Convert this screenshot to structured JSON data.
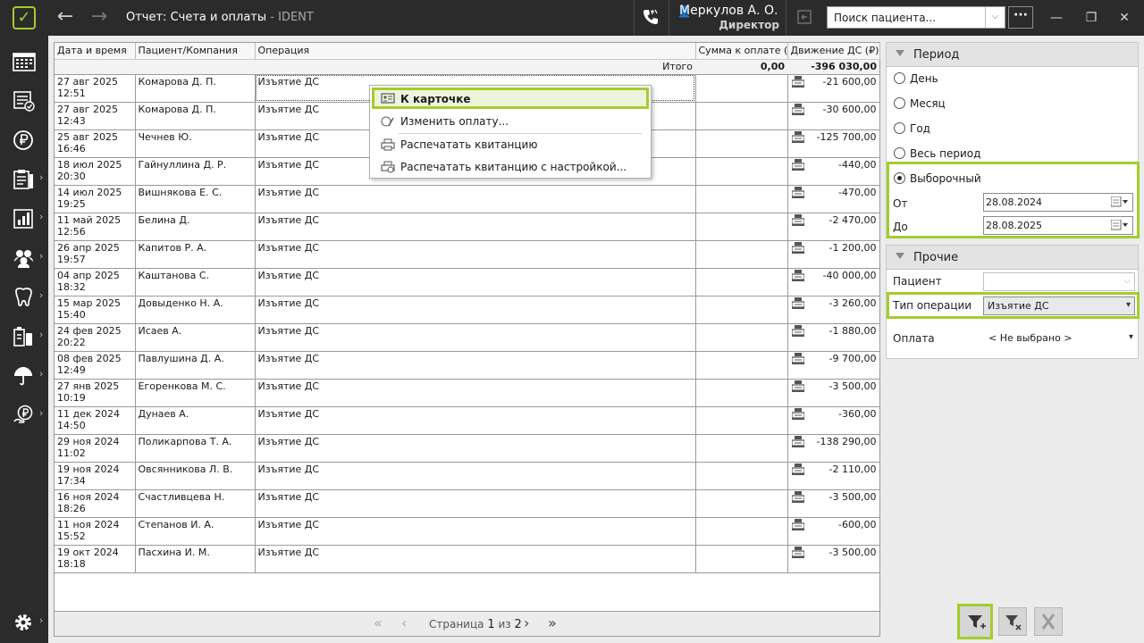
{
  "window": {
    "title": "Отчет: Счета и оплаты",
    "app": "- IDENT"
  },
  "user": {
    "name": "Меркулов А. О.",
    "role": "Директор"
  },
  "search": {
    "placeholder": "Поиск пациента..."
  },
  "table": {
    "columns": [
      "Дата и время",
      "Пациент/Компания",
      "Операция",
      "Сумма к оплате (₽)",
      "Движение ДС (₽)"
    ],
    "total_label": "Итого",
    "total_sum": "0,00",
    "total_move": "-396 030,00",
    "rows": [
      {
        "date": "27 авг 2025",
        "time": "12:51",
        "patient": "Комарова Д. П.",
        "op": "Изъятие ДС",
        "move": "-21 600,00"
      },
      {
        "date": "27 авг 2025",
        "time": "12:43",
        "patient": "Комарова Д. П.",
        "op": "Изъятие ДС",
        "move": "-30 600,00"
      },
      {
        "date": "25 авг 2025",
        "time": "16:46",
        "patient": "Чечнев Ю.",
        "op": "Изъятие ДС",
        "move": "-125 700,00"
      },
      {
        "date": "18 июл 2025",
        "time": "20:30",
        "patient": "Гайнуллина Д. Р.",
        "op": "Изъятие ДС",
        "move": "-440,00"
      },
      {
        "date": "14 июл 2025",
        "time": "19:25",
        "patient": "Вишнякова Е. С.",
        "op": "Изъятие ДС",
        "move": "-470,00"
      },
      {
        "date": "11 май 2025",
        "time": "12:56",
        "patient": "Белина Д.",
        "op": "Изъятие ДС",
        "move": "-2 470,00"
      },
      {
        "date": "26 апр 2025",
        "time": "19:57",
        "patient": "Капитов Р. А.",
        "op": "Изъятие ДС",
        "move": "-1 200,00"
      },
      {
        "date": "04 апр 2025",
        "time": "18:32",
        "patient": "Каштанова С.",
        "op": "Изъятие ДС",
        "move": "-40 000,00"
      },
      {
        "date": "15 мар 2025",
        "time": "15:40",
        "patient": "Довыденко Н. А.",
        "op": "Изъятие ДС",
        "move": "-3 260,00"
      },
      {
        "date": "24 фев 2025",
        "time": "20:22",
        "patient": "Исаев А.",
        "op": "Изъятие ДС",
        "move": "-1 880,00"
      },
      {
        "date": "08 фев 2025",
        "time": "12:49",
        "patient": "Павлушина Д. А.",
        "op": "Изъятие ДС",
        "move": "-9 700,00"
      },
      {
        "date": "27 янв 2025",
        "time": "10:19",
        "patient": "Егоренкова М. С.",
        "op": "Изъятие ДС",
        "move": "-3 500,00"
      },
      {
        "date": "11 дек 2024",
        "time": "14:50",
        "patient": "Дунаев А.",
        "op": "Изъятие ДС",
        "move": "-360,00"
      },
      {
        "date": "29 ноя 2024",
        "time": "11:02",
        "patient": "Поликарпова Т. А.",
        "op": "Изъятие ДС",
        "move": "-138 290,00"
      },
      {
        "date": "19 ноя 2024",
        "time": "17:34",
        "patient": "Овсянникова Л. В.",
        "op": "Изъятие ДС",
        "move": "-2 110,00"
      },
      {
        "date": "16 ноя 2024",
        "time": "18:26",
        "patient": "Счастливцева Н.",
        "op": "Изъятие ДС",
        "move": "-3 500,00"
      },
      {
        "date": "11 ноя 2024",
        "time": "15:52",
        "patient": "Степанов И. А.",
        "op": "Изъятие ДС",
        "move": "-600,00"
      },
      {
        "date": "19 окт 2024",
        "time": "18:18",
        "patient": "Пасхина И. М.",
        "op": "Изъятие ДС",
        "move": "-3 500,00"
      }
    ]
  },
  "pager": {
    "label": "Страница",
    "current": "1",
    "of": "из",
    "total": "2"
  },
  "context_menu": {
    "items": [
      "К карточке",
      "Изменить оплату...",
      "Распечатать квитанцию",
      "Распечатать квитанцию с настройкой..."
    ]
  },
  "filters": {
    "period_title": "Период",
    "period_options": [
      "День",
      "Месяц",
      "Год",
      "Весь период",
      "Выборочный"
    ],
    "selected_period": "Выборочный",
    "from_label": "От",
    "from_value": "28.08.2024",
    "to_label": "До",
    "to_value": "28.08.2025",
    "other_title": "Прочие",
    "patient_label": "Пациент",
    "patient_value": "",
    "optype_label": "Тип операции",
    "optype_value": "Изъятие ДС",
    "payment_label": "Оплата",
    "payment_value": "< Не выбрано >"
  },
  "colors": {
    "accent": "#a5cc2e",
    "dark": "#2b2b2b"
  }
}
